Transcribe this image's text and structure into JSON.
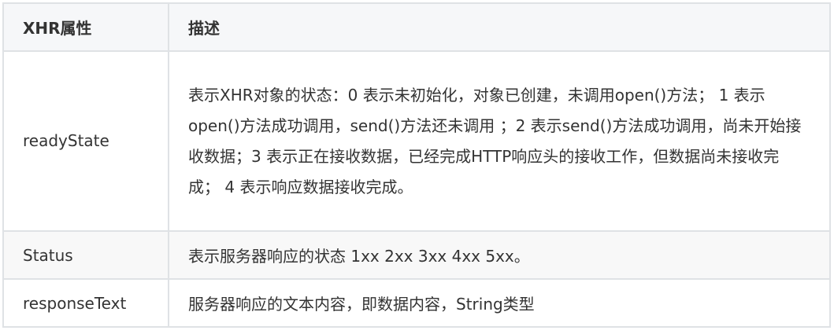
{
  "table": {
    "headers": [
      "XHR属性",
      "描述"
    ],
    "rows": [
      {
        "property": "readyState",
        "description": "表示XHR对象的状态：0 表示未初始化，对象已创建，未调用open()方法； 1 表示open()方法成功调用，send()方法还未调用 ；2 表示send()方法成功调用，尚未开始接收数据；3 表示正在接收数据，已经完成HTTP响应头的接收工作，但数据尚未接收完成； 4 表示响应数据接收完成。"
      },
      {
        "property": "Status",
        "description": "表示服务器响应的状态 1xx 2xx 3xx 4xx 5xx。"
      },
      {
        "property": "responseText",
        "description": "服务器响应的文本内容，即数据内容，String类型"
      }
    ]
  }
}
